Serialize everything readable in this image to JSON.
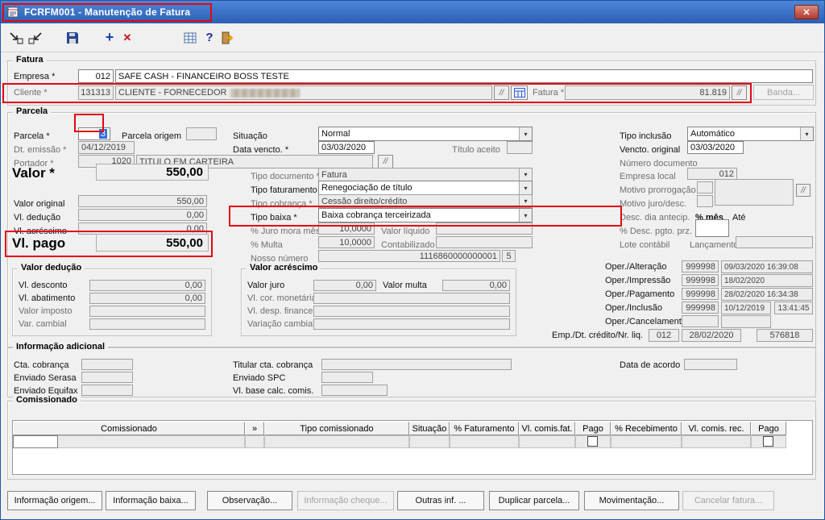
{
  "window": {
    "title": "FCRFM001 - Manutenção de Fatura",
    "close_glyph": "✕"
  },
  "toolbar": {
    "add_glyph": "+",
    "delete_glyph": "✕",
    "help_glyph": "?",
    "lookup_glyph": "//",
    "combo_arrow": "▾"
  },
  "colors": {
    "annotation": "#e30613",
    "selection": "#2f6fe0",
    "titlebar": "#2d5fb4"
  },
  "fatura": {
    "legend": "Fatura",
    "empresa_label": "Empresa *",
    "empresa_code": "012",
    "empresa_name": "SAFE CASH - FINANCEIRO BOSS TESTE",
    "cliente_label": "Cliente *",
    "cliente_code": "131313",
    "cliente_name": "CLIENTE - FORNECEDOR",
    "fatura_label": "Fatura *",
    "fatura_value": "81.819",
    "banda_button": "Banda..."
  },
  "parcela": {
    "legend": "Parcela",
    "parcela_label": "Parcela *",
    "parcela_value": "3",
    "parcela_origem_label": "Parcela origem",
    "situacao_label": "Situação",
    "situacao_value": "Normal",
    "tipo_inclusao_label": "Tipo inclusão",
    "tipo_inclusao_value": "Automático",
    "dt_emissao_label": "Dt. emissão *",
    "dt_emissao_value": "04/12/2019",
    "data_vencto_label": "Data vencto. *",
    "data_vencto_value": "03/03/2020",
    "titulo_aceito_label": "Título aceito",
    "vencto_original_label": "Vencto. original",
    "vencto_original_value": "03/03/2020",
    "portador_label": "Portador *",
    "portador_code": "1020",
    "portador_name": "TITULO EM CARTEIRA",
    "numero_documento_label": "Número documento",
    "valor_label": "Valor *",
    "valor_value": "550,00",
    "tipo_documento_label": "Tipo documento *",
    "tipo_documento_value": "Fatura",
    "empresa_local_label": "Empresa local",
    "empresa_local_value": "012",
    "tipo_faturamento_label": "Tipo faturamento *",
    "tipo_faturamento_value": "Renegociação de título",
    "motivo_prorrogacao_label": "Motivo prorrogação",
    "valor_original_label": "Valor original",
    "valor_original_value": "550,00",
    "tipo_cobranca_label": "Tipo cobrança *",
    "tipo_cobranca_value": "Cessão direito/crédito",
    "motivo_juro_label": "Motivo juro/desc.",
    "vl_deducao_label": "Vl. dedução",
    "vl_deducao_value": "0,00",
    "tipo_baixa_label": "Tipo baixa *",
    "tipo_baixa_value": "Baixa cobrança terceirizada",
    "desc_dia_label": "Desc. dia antecip.",
    "pct_mes_label": "% mês",
    "ate_label": "Até",
    "vl_acrescimo_label": "Vl. acréscimo",
    "vl_acrescimo_value": "0,00",
    "juro_mora_label": "% Juro mora mês",
    "juro_mora_value": "10,0000",
    "valor_liquido_label": "Valor líquido",
    "desc_pgto_label": "% Desc. pgto. prz.",
    "vl_pago_label": "Vl. pago",
    "vl_pago_value": "550,00",
    "multa_label": "% Multa",
    "multa_value": "10,0000",
    "contabilizado_label": "Contabilizado",
    "lote_contabil_label": "Lote contábil",
    "lancamento_label": "Lançamento",
    "nosso_numero_label": "Nosso número",
    "nosso_numero_value": "1116860000000001",
    "nosso_numero_digit": "5"
  },
  "valor_deducao": {
    "legend": "Valor dedução",
    "vl_desconto_label": "Vl. desconto",
    "vl_desconto_value": "0,00",
    "vl_abatimento_label": "Vl. abatimento",
    "vl_abatimento_value": "0,00",
    "valor_imposto_label": "Valor imposto",
    "var_cambial_label": "Var. cambial"
  },
  "valor_acrescimo": {
    "legend": "Valor acréscimo",
    "valor_juro_label": "Valor juro",
    "valor_juro_value": "0,00",
    "valor_multa_label": "Valor multa",
    "valor_multa_value": "0,00",
    "vl_cor_monetaria_label": "Vl. cor. monetária",
    "vl_desp_financeira_label": "Vl. desp. financeira",
    "variacao_cambial_label": "Variação cambial"
  },
  "oper": {
    "alteracao_label": "Oper./Alteração",
    "alteracao_code": "999998",
    "alteracao_dt": "09/03/2020 16:39:08",
    "impressao_label": "Oper./Impressão",
    "impressao_code": "999998",
    "impressao_dt": "18/02/2020",
    "pagamento_label": "Oper./Pagamento",
    "pagamento_code": "999998",
    "pagamento_dt": "28/02/2020 16:34:38",
    "inclusao_label": "Oper./Inclusão",
    "inclusao_code": "999998",
    "inclusao_date": "10/12/2019",
    "inclusao_time": "13:41:45",
    "cancelamento_label": "Oper./Cancelamento",
    "emp_label": "Emp./Dt. crédito/Nr. liq.",
    "emp_code": "012",
    "emp_date": "28/02/2020",
    "emp_nr": "576818"
  },
  "info_adicional": {
    "legend": "Informação adicional",
    "cta_cobranca_label": "Cta. cobrança",
    "titular_label": "Titular cta. cobrança",
    "data_acordo_label": "Data de acordo",
    "enviado_serasa_label": "Enviado Serasa",
    "enviado_spc_label": "Enviado SPC",
    "enviado_equifax_label": "Enviado Equifax",
    "vl_base_calc_label": "Vl. base calc. comis."
  },
  "comissionado": {
    "legend": "Comissionado",
    "headers": [
      "Comissionado",
      "»",
      "Tipo comissionado",
      "Situação",
      "% Faturamento",
      "Vl. comis.fat.",
      "Pago",
      "% Recebimento",
      "Vl. comis. rec.",
      "Pago"
    ]
  },
  "footer_buttons": [
    "Informação origem...",
    "Informação baixa...",
    "Observação...",
    "Informação cheque...",
    "Outras inf. ...",
    "Duplicar parcela...",
    "Movimentação...",
    "Cancelar fatura..."
  ]
}
